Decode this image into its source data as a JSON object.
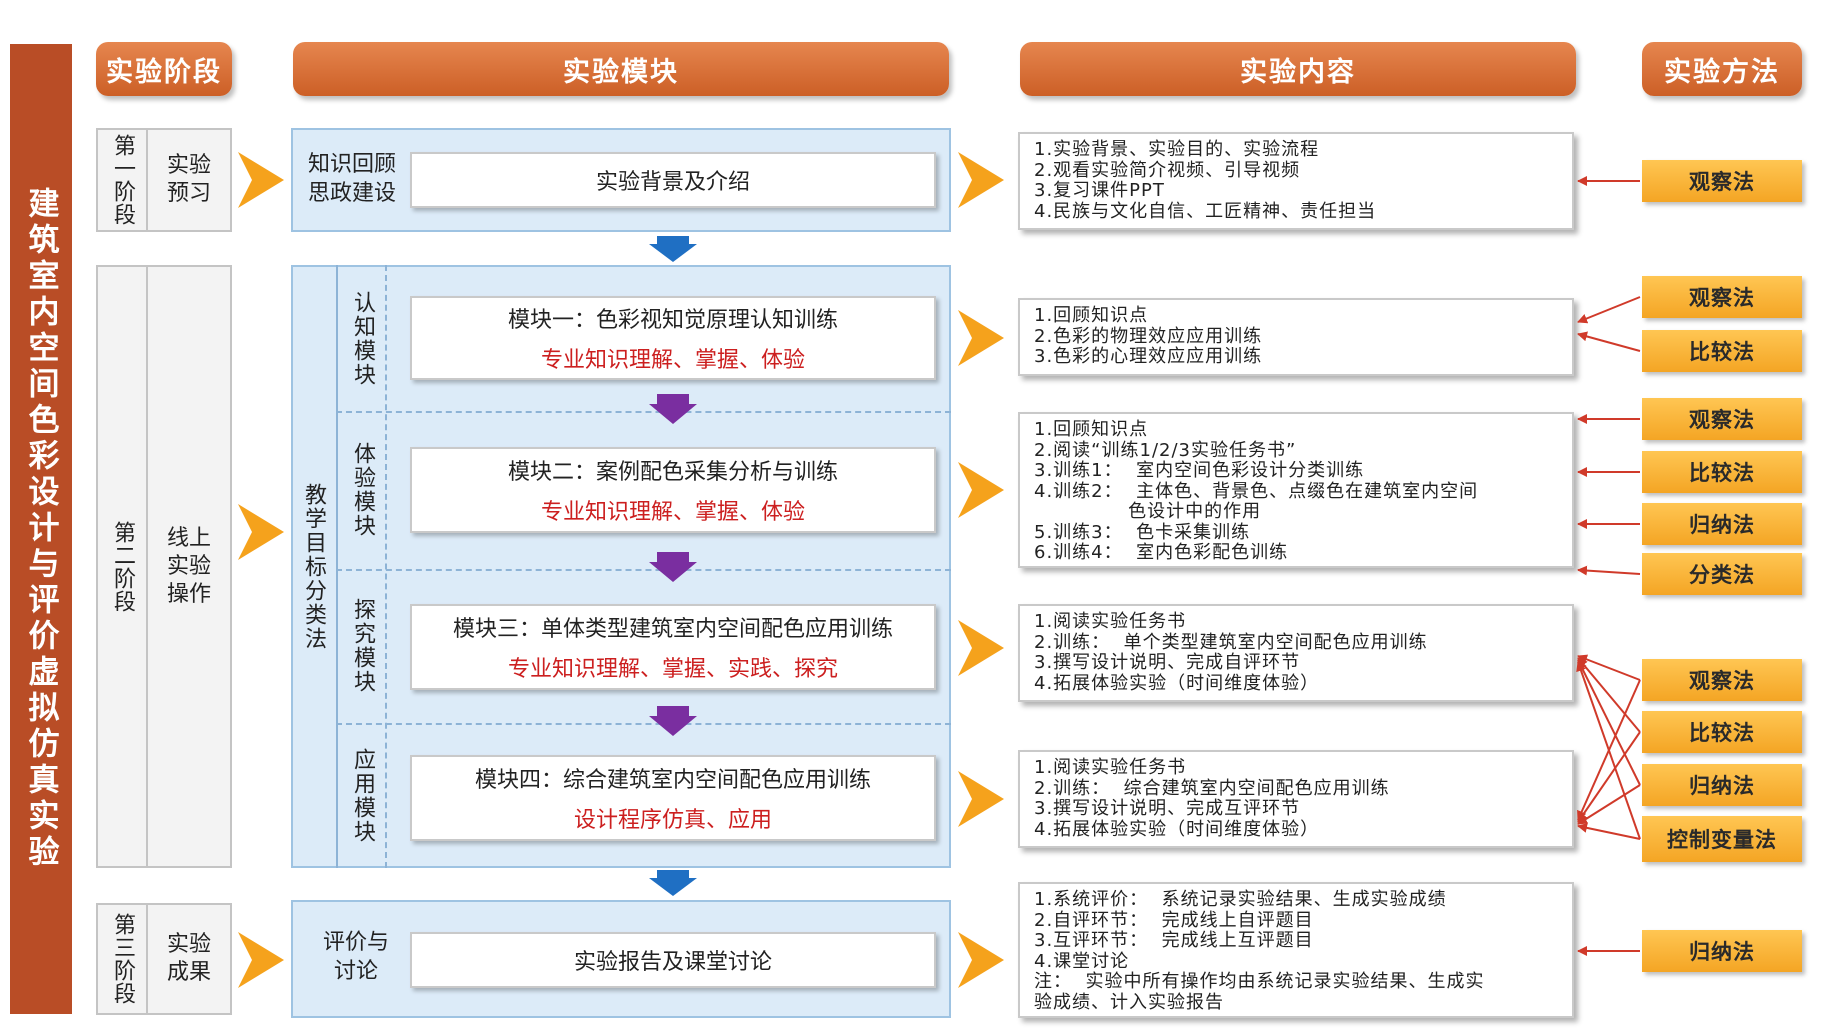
{
  "side_title": "建筑室内空间色彩设计与评价虚拟仿真实验",
  "headers": {
    "stage": "实验阶段",
    "module": "实验模块",
    "content": "实验内容",
    "method": "实验方法"
  },
  "stages": [
    {
      "num": "第一阶段",
      "name": "实验\n预习"
    },
    {
      "num": "第二阶段",
      "name": "线上\n实验\n操作"
    },
    {
      "num": "第三阶段",
      "name": "实验\n成果"
    }
  ],
  "stage1_module": {
    "label": "知识回顾\n思政建设",
    "box": "实验背景及介绍"
  },
  "stage2_module": {
    "label": "教学目标分类法",
    "rows": [
      {
        "category": "认知模块",
        "title": "模块一：色彩视知觉原理认知训练",
        "sub": "专业知识理解、掌握、体验"
      },
      {
        "category": "体验模块",
        "title": "模块二：案例配色采集分析与训练",
        "sub": "专业知识理解、掌握、体验"
      },
      {
        "category": "探究模块",
        "title": "模块三：单体类型建筑室内空间配色应用训练",
        "sub": "专业知识理解、掌握、实践、探究"
      },
      {
        "category": "应用模块",
        "title": "模块四：综合建筑室内空间配色应用训练",
        "sub": "设计程序仿真、应用"
      }
    ]
  },
  "stage3_module": {
    "label": "评价与\n讨论",
    "box": "实验报告及课堂讨论"
  },
  "contents": [
    [
      "1.实验背景、实验目的、实验流程",
      "2.观看实验简介视频、引导视频",
      "3.复习课件PPT",
      "4.民族与文化自信、工匠精神、责任担当"
    ],
    [
      "1.回顾知识点",
      "2.色彩的物理效应应用训练",
      "3.色彩的心理效应应用训练"
    ],
    [
      "1.回顾知识点",
      "2.阅读“训练1/2/3实验任务书”",
      "3.训练1：  室内空间色彩设计分类训练",
      "4.训练2：  主体色、背景色、点缀色在建筑室内空间",
      "              色设计中的作用",
      "5.训练3：  色卡采集训练",
      "6.训练4：  室内色彩配色训练"
    ],
    [
      "1.阅读实验任务书",
      "2.训练：  单个类型建筑室内空间配色应用训练",
      "3.撰写设计说明、完成自评环节",
      "4.拓展体验实验（时间维度体验）"
    ],
    [
      "1.阅读实验任务书",
      "2.训练：  综合建筑室内空间配色应用训练",
      "3.撰写设计说明、完成互评环节",
      "4.拓展体验实验（时间维度体验）"
    ],
    [
      "1.系统评价：  系统记录实验结果、生成实验成绩",
      "2.自评环节：  完成线上自评题目",
      "3.互评环节：  完成线上互评题目",
      "4.课堂讨论",
      "注：  实验中所有操作均由系统记录实验结果、生成实",
      "验成绩、计入实验报告"
    ]
  ],
  "methods": [
    "观察法",
    "观察法",
    "比较法",
    "观察法",
    "比较法",
    "归纳法",
    "分类法",
    "观察法",
    "比较法",
    "归纳法",
    "控制变量法",
    "归纳法"
  ],
  "colors": {
    "sidebar": "#b94d26",
    "header": "#d86a33",
    "module_bg": "#dcebf8",
    "module_border": "#9ec3e2",
    "big_arrow": "#f5a21c",
    "down_arrow_blue": "#1f6fc3",
    "down_arrow_purple": "#7a2ea0",
    "method_bg": "#f8b43a",
    "connector": "#d03a2a",
    "subtitle_red": "#cc1f1f"
  }
}
